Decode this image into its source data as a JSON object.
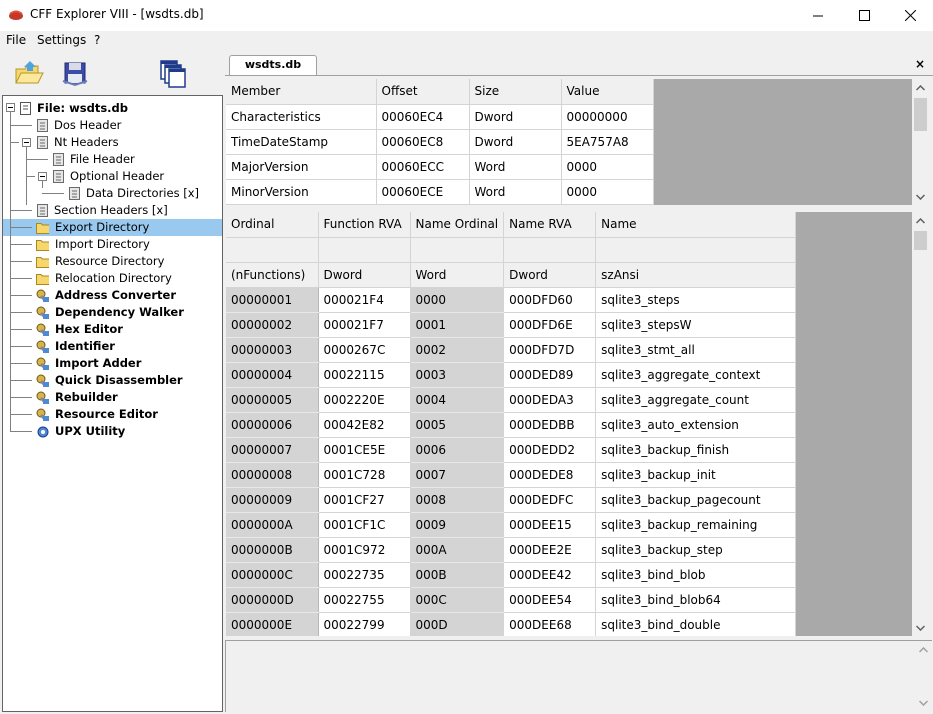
{
  "window": {
    "title": "CFF Explorer VIII - [wsdts.db]"
  },
  "menu": {
    "file": "File",
    "settings": "Settings",
    "help": "?"
  },
  "tab": {
    "label": "wsdts.db",
    "close": "×"
  },
  "tree": {
    "root": "File: wsdts.db",
    "items": [
      {
        "label": "Dos Header"
      },
      {
        "label": "Nt Headers"
      },
      {
        "label": "File Header"
      },
      {
        "label": "Optional Header"
      },
      {
        "label": "Data Directories [x]"
      },
      {
        "label": "Section Headers [x]"
      },
      {
        "label": "Export Directory"
      },
      {
        "label": "Import Directory"
      },
      {
        "label": "Resource Directory"
      },
      {
        "label": "Relocation Directory"
      },
      {
        "label": "Address Converter"
      },
      {
        "label": "Dependency Walker"
      },
      {
        "label": "Hex Editor"
      },
      {
        "label": "Identifier"
      },
      {
        "label": "Import Adder"
      },
      {
        "label": "Quick Disassembler"
      },
      {
        "label": "Rebuilder"
      },
      {
        "label": "Resource Editor"
      },
      {
        "label": "UPX Utility"
      }
    ]
  },
  "grid1": {
    "headers": [
      "Member",
      "Offset",
      "Size",
      "Value"
    ],
    "rows": [
      [
        "Characteristics",
        "00060EC4",
        "Dword",
        "00000000"
      ],
      [
        "TimeDateStamp",
        "00060EC8",
        "Dword",
        "5EA757A8"
      ],
      [
        "MajorVersion",
        "00060ECC",
        "Word",
        "0000"
      ],
      [
        "MinorVersion",
        "00060ECE",
        "Word",
        "0000"
      ]
    ]
  },
  "grid2": {
    "headers": [
      "Ordinal",
      "Function RVA",
      "Name Ordinal",
      "Name RVA",
      "Name"
    ],
    "types": [
      "(nFunctions)",
      "Dword",
      "Word",
      "Dword",
      "szAnsi"
    ],
    "rows": [
      [
        "00000001",
        "000021F4",
        "0000",
        "000DFD60",
        "sqlite3_steps"
      ],
      [
        "00000002",
        "000021F7",
        "0001",
        "000DFD6E",
        "sqlite3_stepsW"
      ],
      [
        "00000003",
        "0000267C",
        "0002",
        "000DFD7D",
        "sqlite3_stmt_all"
      ],
      [
        "00000004",
        "00022115",
        "0003",
        "000DED89",
        "sqlite3_aggregate_context"
      ],
      [
        "00000005",
        "0002220E",
        "0004",
        "000DEDA3",
        "sqlite3_aggregate_count"
      ],
      [
        "00000006",
        "00042E82",
        "0005",
        "000DEDBB",
        "sqlite3_auto_extension"
      ],
      [
        "00000007",
        "0001CE5E",
        "0006",
        "000DEDD2",
        "sqlite3_backup_finish"
      ],
      [
        "00000008",
        "0001C728",
        "0007",
        "000DEDE8",
        "sqlite3_backup_init"
      ],
      [
        "00000009",
        "0001CF27",
        "0008",
        "000DEDFC",
        "sqlite3_backup_pagecount"
      ],
      [
        "0000000A",
        "0001CF1C",
        "0009",
        "000DEE15",
        "sqlite3_backup_remaining"
      ],
      [
        "0000000B",
        "0001C972",
        "000A",
        "000DEE2E",
        "sqlite3_backup_step"
      ],
      [
        "0000000C",
        "00022735",
        "000B",
        "000DEE42",
        "sqlite3_bind_blob"
      ],
      [
        "0000000D",
        "00022755",
        "000C",
        "000DEE54",
        "sqlite3_bind_blob64"
      ],
      [
        "0000000E",
        "00022799",
        "000D",
        "000DEE68",
        "sqlite3_bind_double"
      ]
    ]
  }
}
